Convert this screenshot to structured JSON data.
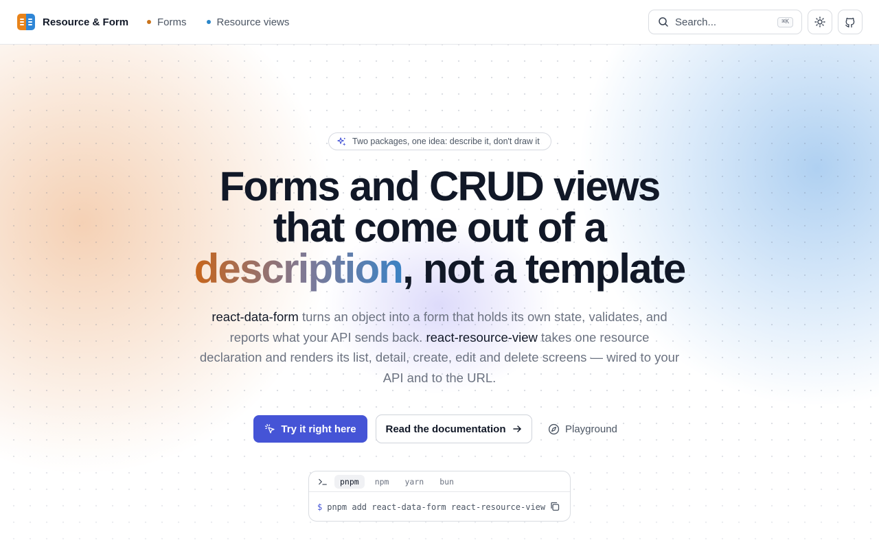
{
  "header": {
    "brand_name": "Resource & Form",
    "nav": [
      {
        "label": "Forms",
        "dot_color": "#c9731b"
      },
      {
        "label": "Resource views",
        "dot_color": "#2a86c9"
      }
    ],
    "search": {
      "placeholder": "Search...",
      "shortcut": "⌘K"
    },
    "icons": [
      "sun-icon",
      "github-icon"
    ]
  },
  "hero": {
    "pill_text": "Two packages, one idea: describe it, don't draw it",
    "headline": {
      "line1": "Forms and CRUD views",
      "line2": "that come out of a",
      "highlight": "description",
      "rest": ", not a template"
    },
    "subtitle": {
      "pkg1": "react-data-form",
      "text1": " turns an object into a form that holds its own state, validates, and reports what your API sends back. ",
      "pkg2": "react-resource-view",
      "text2": " takes one resource declaration and renders its list, detail, create, edit and delete screens — wired to your API and to the URL."
    },
    "buttons": {
      "primary": "Try it right here",
      "secondary": "Read the documentation",
      "ghost": "Playground"
    },
    "install": {
      "tabs": [
        "pnpm",
        "npm",
        "yarn",
        "bun"
      ],
      "active_tab": "pnpm",
      "prompt": "$",
      "command": "pnpm add react-data-form react-resource-view"
    }
  },
  "colors": {
    "accent": "#4554d6",
    "gradient_start": "#c8651a",
    "gradient_end": "#3b82c4"
  }
}
